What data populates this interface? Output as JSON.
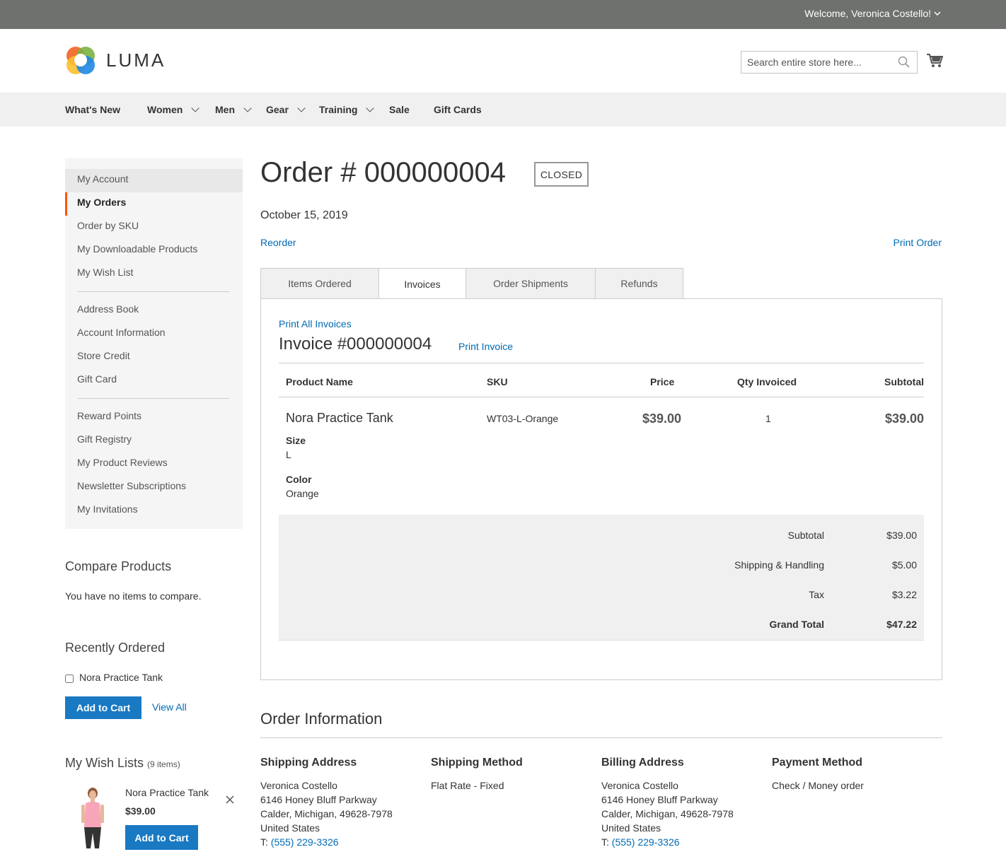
{
  "topbar": {
    "welcome": "Welcome, Veronica Costello!"
  },
  "header": {
    "logo_text": "LUMA",
    "search_placeholder": "Search entire store here..."
  },
  "nav": [
    "What's New",
    "Women",
    "Men",
    "Gear",
    "Training",
    "Sale",
    "Gift Cards"
  ],
  "sidebar": {
    "items": [
      "My Account",
      "My Orders",
      "Order by SKU",
      "My Downloadable Products",
      "My Wish List",
      "Address Book",
      "Account Information",
      "Store Credit",
      "Gift Card",
      "Reward Points",
      "Gift Registry",
      "My Product Reviews",
      "Newsletter Subscriptions",
      "My Invitations"
    ]
  },
  "compare": {
    "title": "Compare Products",
    "empty": "You have no items to compare."
  },
  "recent": {
    "title": "Recently Ordered",
    "item": "Nora Practice Tank",
    "add_to_cart": "Add to Cart",
    "view_all": "View All"
  },
  "wishlist": {
    "title": "My Wish Lists",
    "count": "(9 items)",
    "item_name": "Nora Practice Tank",
    "item_price": "$39.00",
    "add_to_cart": "Add to Cart"
  },
  "order": {
    "title": "Order # 000000004",
    "status": "CLOSED",
    "date": "October 15, 2019",
    "reorder": "Reorder",
    "print_order": "Print Order",
    "tabs": [
      "Items Ordered",
      "Invoices",
      "Order Shipments",
      "Refunds"
    ]
  },
  "invoice": {
    "print_all": "Print All Invoices",
    "title": "Invoice #000000004",
    "print_invoice": "Print Invoice",
    "columns": [
      "Product Name",
      "SKU",
      "Price",
      "Qty Invoiced",
      "Subtotal"
    ],
    "row": {
      "name": "Nora Practice Tank",
      "sku": "WT03-L-Orange",
      "price": "$39.00",
      "qty": "1",
      "subtotal": "$39.00",
      "size_label": "Size",
      "size": "L",
      "color_label": "Color",
      "color": "Orange"
    },
    "totals": [
      {
        "label": "Subtotal",
        "value": "$39.00"
      },
      {
        "label": "Shipping & Handling",
        "value": "$5.00"
      },
      {
        "label": "Tax",
        "value": "$3.22"
      },
      {
        "label": "Grand Total",
        "value": "$47.22"
      }
    ]
  },
  "order_info": {
    "title": "Order Information",
    "shipping_address": {
      "title": "Shipping Address",
      "lines": [
        "Veronica Costello",
        "6146 Honey Bluff Parkway",
        "Calder, Michigan, 49628-7978",
        "United States"
      ],
      "phone_prefix": "T:",
      "phone": "(555) 229-3326"
    },
    "shipping_method": {
      "title": "Shipping Method",
      "value": "Flat Rate - Fixed"
    },
    "billing_address": {
      "title": "Billing Address",
      "lines": [
        "Veronica Costello",
        "6146 Honey Bluff Parkway",
        "Calder, Michigan, 49628-7978",
        "United States"
      ],
      "phone_prefix": "T:",
      "phone": "(555) 229-3326"
    },
    "payment_method": {
      "title": "Payment Method",
      "value": "Check / Money order"
    }
  },
  "colors": {
    "primary_button": "#1979c3",
    "link": "#006bb4",
    "active_marker": "#ff5501",
    "topbar": "#6e716e"
  }
}
